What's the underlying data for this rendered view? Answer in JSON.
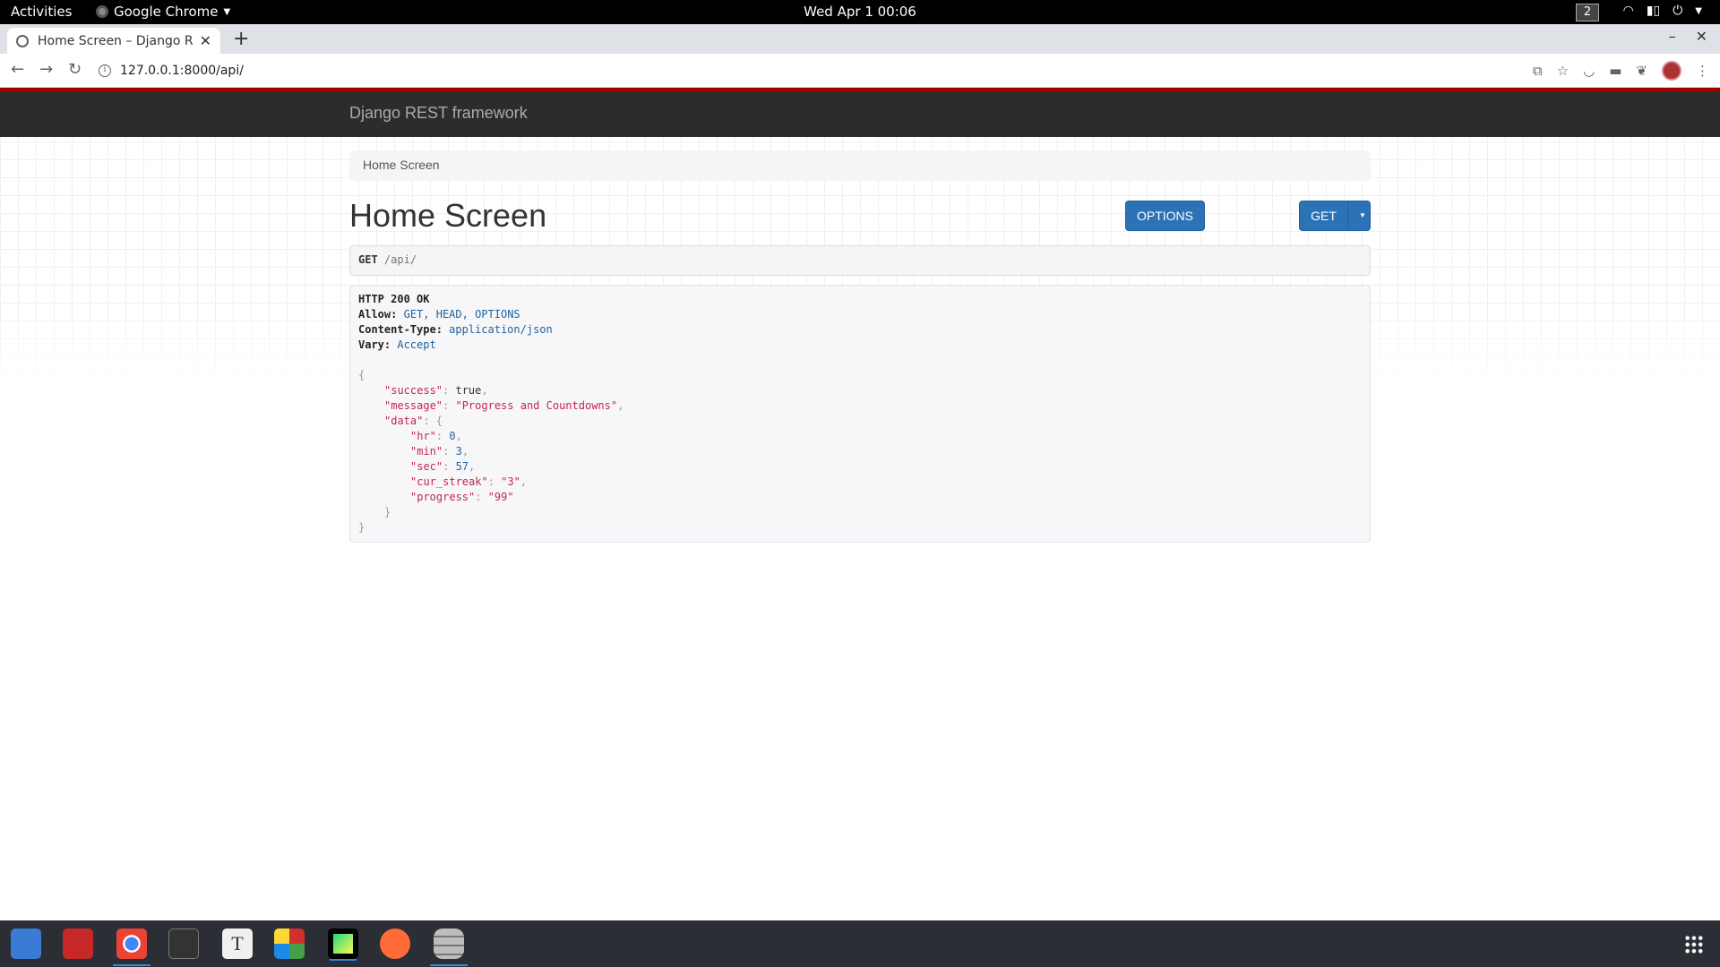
{
  "system": {
    "activities": "Activities",
    "app_name": "Google Chrome",
    "clock": "Wed Apr 1  00:06",
    "workspace": "2"
  },
  "browser": {
    "tab_title": "Home Screen – Django RE",
    "url": "127.0.0.1:8000/api/"
  },
  "drf": {
    "brand": "Django REST framework",
    "breadcrumb": "Home Screen",
    "title": "Home Screen",
    "options_label": "OPTIONS",
    "get_label": "GET",
    "request": {
      "method": "GET",
      "path": "/api/"
    },
    "response": {
      "status": "HTTP 200 OK",
      "headers": [
        {
          "name": "Allow:",
          "value": "GET, HEAD, OPTIONS"
        },
        {
          "name": "Content-Type:",
          "value": "application/json"
        },
        {
          "name": "Vary:",
          "value": "Accept"
        }
      ],
      "body": {
        "success_key": "\"success\"",
        "success_val": "true",
        "message_key": "\"message\"",
        "message_val": "\"Progress and Countdowns\"",
        "data_key": "\"data\"",
        "hr_key": "\"hr\"",
        "hr_val": "0",
        "min_key": "\"min\"",
        "min_val": "3",
        "sec_key": "\"sec\"",
        "sec_val": "57",
        "cur_streak_key": "\"cur_streak\"",
        "cur_streak_val": "\"3\"",
        "progress_key": "\"progress\"",
        "progress_val": "\"99\""
      }
    }
  },
  "dock": {
    "items": [
      "files-icon",
      "screenshot-icon",
      "chrome-icon",
      "system-monitor-icon",
      "text-editor-icon",
      "office-icon",
      "pycharm-icon",
      "postman-icon",
      "database-icon"
    ],
    "colors": {
      "files": "#3a7bd5",
      "screenshot": "#c62828",
      "chrome": "#e0e0e0",
      "monitor": "#333333",
      "text": "#f0f0f0",
      "office": "#d32f2f",
      "pycharm": "#21d789",
      "postman": "#ff6c37",
      "database": "#bdbdbd"
    }
  }
}
